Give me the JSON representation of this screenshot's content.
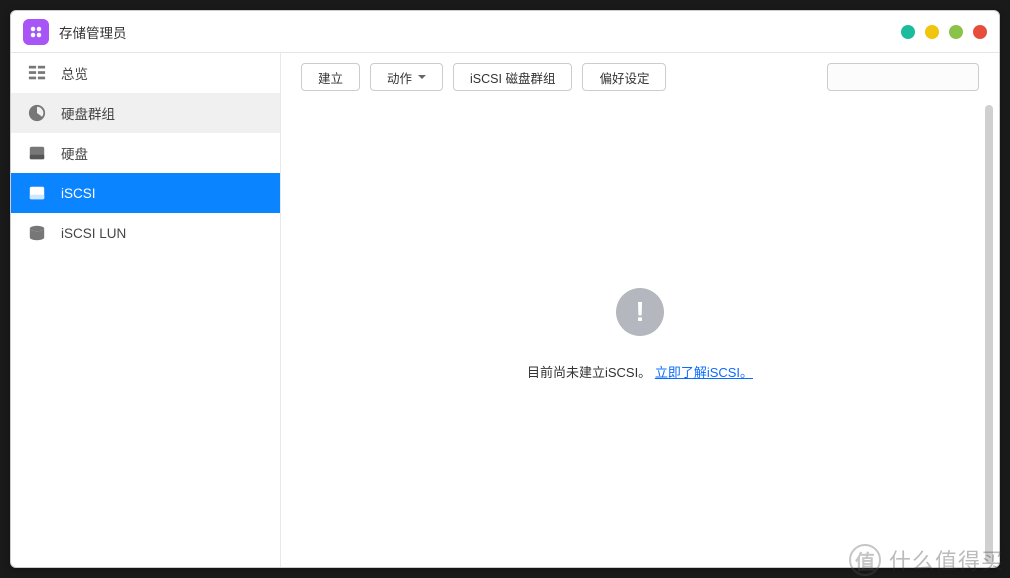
{
  "app": {
    "title": "存储管理员"
  },
  "sidebar": {
    "items": [
      {
        "label": "总览"
      },
      {
        "label": "硬盘群组"
      },
      {
        "label": "硬盘"
      },
      {
        "label": "iSCSI"
      },
      {
        "label": "iSCSI LUN"
      }
    ]
  },
  "toolbar": {
    "create": "建立",
    "action": "动作",
    "iscsi_group": "iSCSI 磁盘群组",
    "preferences": "偏好设定"
  },
  "search": {
    "placeholder": ""
  },
  "empty": {
    "message_prefix": "目前尚未建立iSCSI。",
    "link_text": "立即了解iSCSI。"
  },
  "watermark": {
    "text": "什么值得买"
  }
}
